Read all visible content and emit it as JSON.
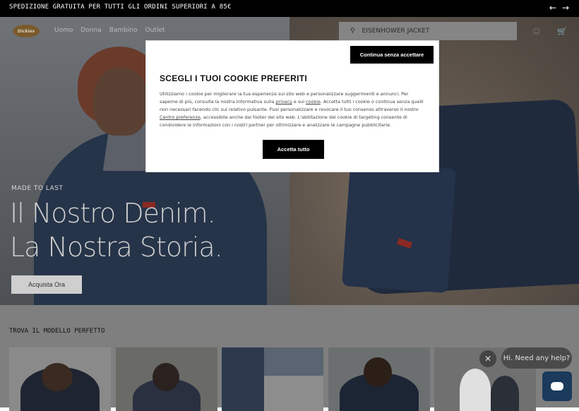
{
  "announcement": {
    "text": "SPEDIZIONE GRATUITA PER TUTTI GLI ORDINI SUPERIORI A 85€",
    "prev_icon": "arrow-left-icon",
    "next_icon": "arrow-right-icon"
  },
  "header": {
    "logo_text": "Dickies",
    "nav": [
      "Uomo",
      "Donna",
      "Bambino",
      "Outlet"
    ],
    "search_value": "EISENHOWER JACKET",
    "search_icon": "search-icon",
    "account_icon": "user-icon",
    "cart_icon": "cart-icon"
  },
  "hero": {
    "kicker": "MADE TO LAST",
    "title_line1": "Il Nostro Denim.",
    "title_line2": "La Nostra Storia.",
    "cta": "Acquista Ora"
  },
  "section": {
    "title": "TROVA IL MODELLO PERFETTO"
  },
  "cookie_modal": {
    "skip_label": "Continua senza accettare",
    "title": "SCEGLI I TUOI COOKIE PREFERITI",
    "body_1": "Utilizziamo i cookie per migliorare la tua esperienza sul sito web e personalizzare suggerimenti e annunci. Per saperne di più, consulta la nostra Informativa sulla ",
    "link_privacy": "privacy",
    "body_2": " e sui ",
    "link_cookie": "cookie",
    "body_3": ". Accetta tutti i cookie o continua senza quelli non necessari facendo clic sul relativo pulsante. Puoi personalizzare e revocare il tuo consenso attraverso il nostro ",
    "link_prefs": "Centro preferenze",
    "body_4": ", accessibile anche dal footer del sito web. L'abilitazione dei cookie di targeting consente di condividere le informazioni con i nostri partner per ottimizzare e analizzare le campagne pubblicitarie.",
    "accept_label": "Accetta tutto"
  },
  "chat": {
    "close_icon": "close-icon",
    "bubble": "Hi. Need any help?",
    "launcher_icon": "chat-icon"
  }
}
